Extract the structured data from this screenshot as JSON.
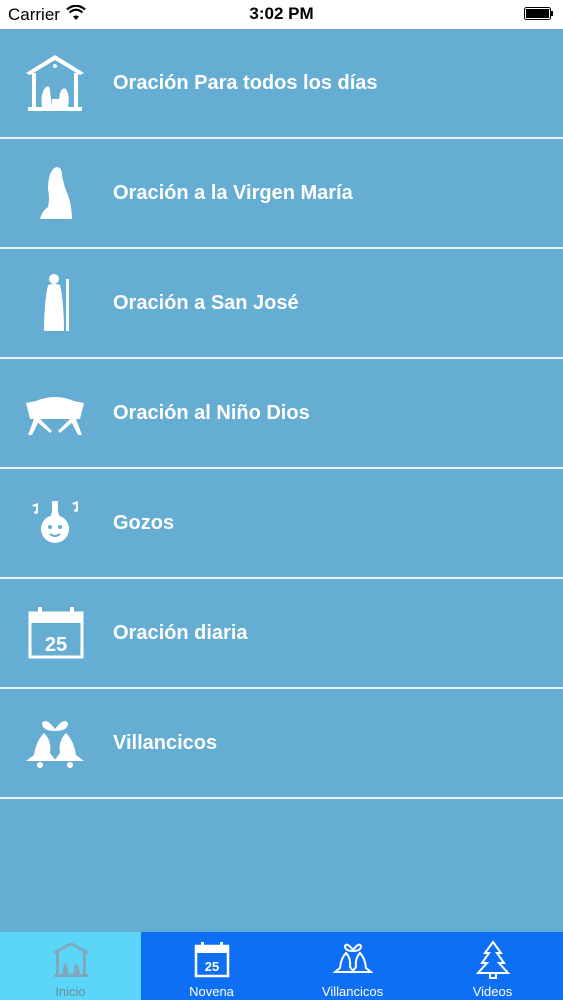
{
  "status_bar": {
    "carrier": "Carrier",
    "time": "3:02 PM",
    "icons": [
      "wifi-icon",
      "battery-icon"
    ]
  },
  "menu": {
    "items": [
      {
        "label": "Oración Para todos los días",
        "icon": "nativity-icon"
      },
      {
        "label": "Oración a la Virgen María",
        "icon": "virgin-mary-icon"
      },
      {
        "label": "Oración a San José",
        "icon": "saint-joseph-icon"
      },
      {
        "label": "Oración al Niño Dios",
        "icon": "manger-icon"
      },
      {
        "label": "Gozos",
        "icon": "singing-bell-icon"
      },
      {
        "label": "Oración diaria",
        "icon": "calendar-icon"
      },
      {
        "label": "Villancicos",
        "icon": "bells-icon"
      }
    ]
  },
  "tabbar": {
    "tabs": [
      {
        "label": "Inicio",
        "icon": "nativity-icon",
        "active": true
      },
      {
        "label": "Novena",
        "icon": "calendar-icon",
        "active": false
      },
      {
        "label": "Villancicos",
        "icon": "bells-icon",
        "active": false
      },
      {
        "label": "Videos",
        "icon": "christmas-tree-icon",
        "active": false
      }
    ]
  },
  "colors": {
    "list_background": "#65add2",
    "separator": "#e8f3f9",
    "tabbar_background": "#0f6ff4",
    "tab_active_background": "#5bd6f8",
    "text": "#ffffff"
  },
  "calendar_day": "25"
}
